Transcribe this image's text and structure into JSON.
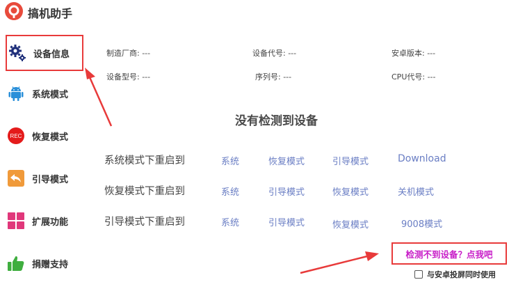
{
  "app": {
    "title": "搞机助手"
  },
  "sidebar": {
    "items": [
      {
        "label": "设备信息",
        "icon": "gears-icon"
      },
      {
        "label": "系统模式",
        "icon": "android-icon"
      },
      {
        "label": "恢复模式",
        "icon": "rec-icon",
        "icon_text": "REC"
      },
      {
        "label": "引导模式",
        "icon": "back-arrow-icon"
      },
      {
        "label": "扩展功能",
        "icon": "grid-icon"
      },
      {
        "label": "捐赠支持",
        "icon": "thumbs-up-icon"
      }
    ]
  },
  "device_info": {
    "manufacturer": "制造厂商: ---",
    "codename": "设备代号: ---",
    "android_version": "安卓版本: ---",
    "model": "设备型号: ---",
    "serial": "序列号: ---",
    "cpu": "CPU代号: ---"
  },
  "status": {
    "message": "没有检测到设备"
  },
  "reboot": {
    "system_mode": {
      "title": "系统模式下重启到",
      "options": [
        "系统",
        "恢复模式",
        "引导模式",
        "Download"
      ]
    },
    "recovery_mode": {
      "title": "恢复模式下重启到",
      "options": [
        "系统",
        "引导模式",
        "恢复模式",
        "关机模式"
      ]
    },
    "bootloader_mode": {
      "title": "引导模式下重启到",
      "options": [
        "系统",
        "引导模式",
        "恢复模式",
        "9008模式"
      ]
    }
  },
  "help": {
    "link": "检测不到设备？点我吧"
  },
  "mirror": {
    "label": "与安卓投屏同时使用",
    "checked": false
  },
  "colors": {
    "accent_red": "#e83a3a",
    "link_blue": "#6a7ec4",
    "help_magenta": "#c81ec8"
  }
}
